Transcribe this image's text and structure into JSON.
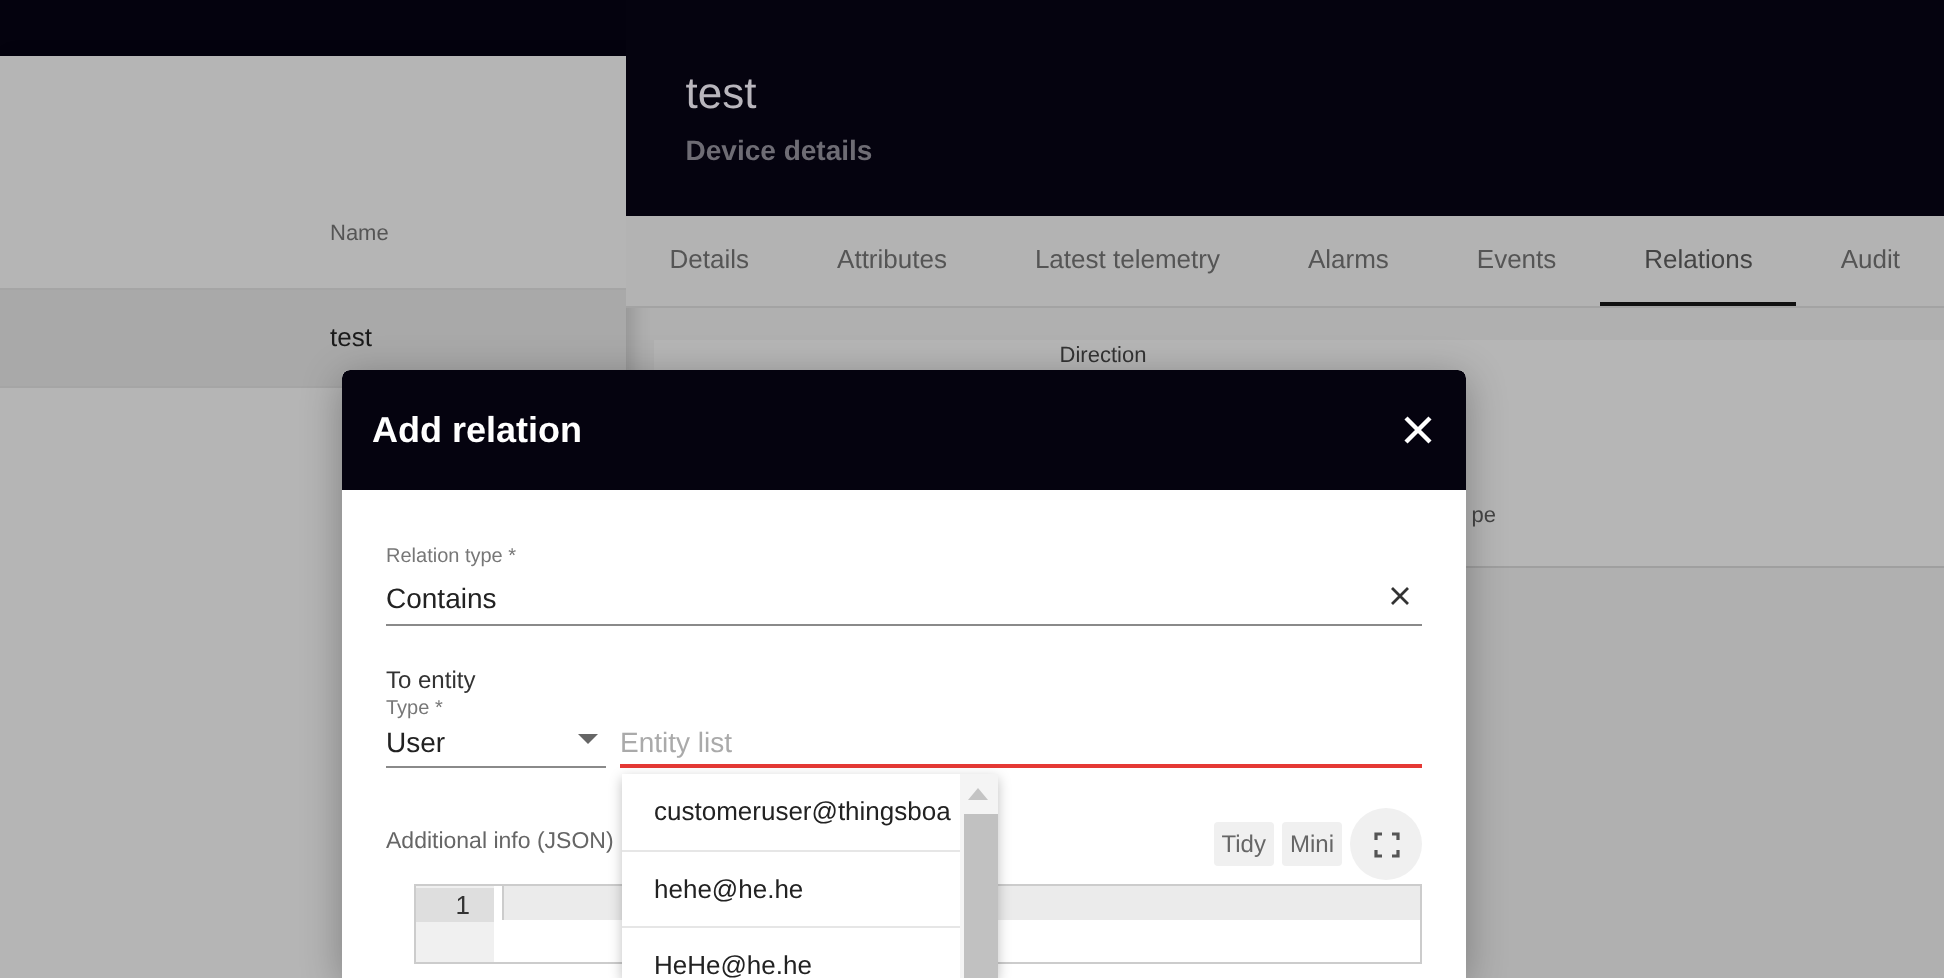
{
  "device_list": {
    "column_header": "Name",
    "rows": [
      {
        "name": "test",
        "selected": true
      }
    ]
  },
  "device_panel": {
    "title": "test",
    "subtitle": "Device details",
    "tabs": [
      {
        "label": "Details",
        "selected": false
      },
      {
        "label": "Attributes",
        "selected": false
      },
      {
        "label": "Latest telemetry",
        "selected": false
      },
      {
        "label": "Alarms",
        "selected": false
      },
      {
        "label": "Events",
        "selected": false
      },
      {
        "label": "Relations",
        "selected": true
      },
      {
        "label": "Audit",
        "selected": false
      }
    ],
    "relations_table": {
      "column_1": "Direction",
      "column_2": "pe"
    }
  },
  "dialog": {
    "title": "Add relation",
    "relation_type": {
      "label": "Relation type *",
      "value": "Contains"
    },
    "to_entity": {
      "label": "To entity",
      "type_label": "Type *",
      "type_value": "User",
      "entity_placeholder": "Entity list",
      "invalid": true
    },
    "entity_options": [
      {
        "label": "customeruser@thingsboa",
        "selected": false
      },
      {
        "label": "hehe@he.he",
        "selected": false
      },
      {
        "label": "HeHe@he.he",
        "selected": false
      }
    ],
    "additional_info": {
      "label": "Additional info (JSON)",
      "buttons": [
        "Tidy",
        "Mini"
      ],
      "line_numbers": [
        "1"
      ]
    }
  }
}
